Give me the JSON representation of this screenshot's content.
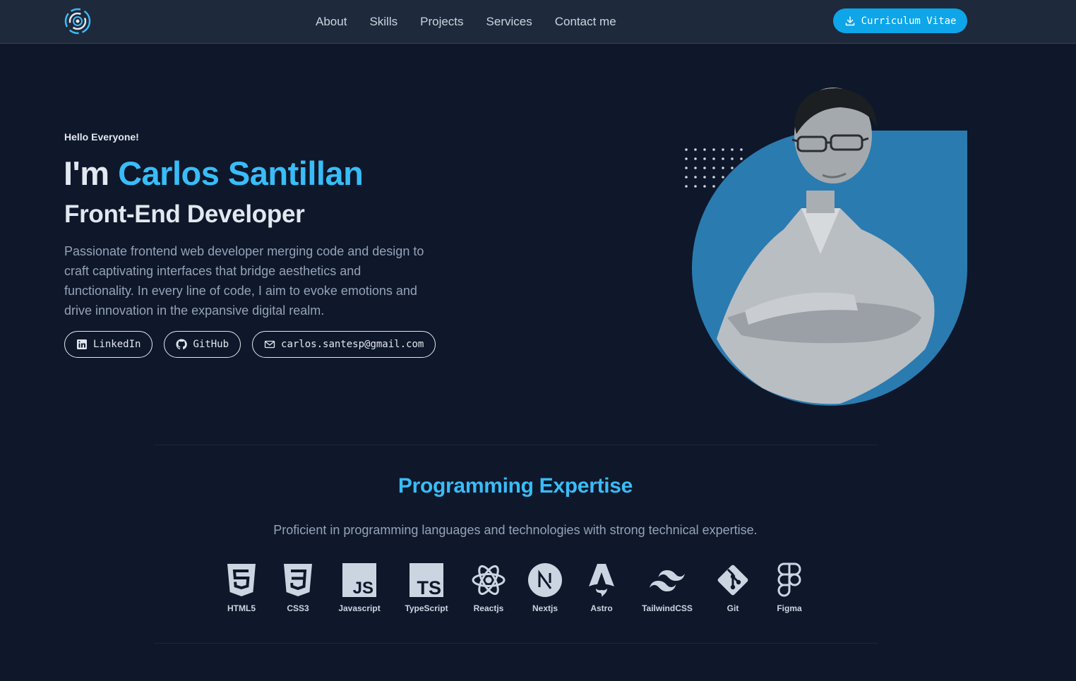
{
  "nav": {
    "items": [
      {
        "label": "About"
      },
      {
        "label": "Skills"
      },
      {
        "label": "Projects"
      },
      {
        "label": "Services"
      },
      {
        "label": "Contact me"
      }
    ],
    "cv_label": "Curriculum Vitae"
  },
  "hero": {
    "greeting": "Hello Everyone!",
    "name_prefix": "I'm ",
    "name": "Carlos Santillan",
    "role": "Front-End Developer",
    "description": "Passionate frontend web developer merging code and design to craft captivating interfaces that bridge aesthetics and functionality. In every line of code, I aim to evoke emotions and drive innovation in the expansive digital realm.",
    "links": {
      "linkedin": "LinkedIn",
      "github": "GitHub",
      "email": "carlos.santesp@gmail.com"
    }
  },
  "skills": {
    "title": "Programming Expertise",
    "subtitle": "Proficient in programming languages and technologies with strong technical expertise.",
    "items": [
      {
        "label": "HTML5",
        "icon": "html5-icon"
      },
      {
        "label": "CSS3",
        "icon": "css3-icon"
      },
      {
        "label": "Javascript",
        "icon": "javascript-icon"
      },
      {
        "label": "TypeScript",
        "icon": "typescript-icon"
      },
      {
        "label": "Reactjs",
        "icon": "react-icon"
      },
      {
        "label": "Nextjs",
        "icon": "nextjs-icon"
      },
      {
        "label": "Astro",
        "icon": "astro-icon"
      },
      {
        "label": "TailwindCSS",
        "icon": "tailwind-icon"
      },
      {
        "label": "Git",
        "icon": "git-icon"
      },
      {
        "label": "Figma",
        "icon": "figma-icon"
      }
    ]
  },
  "colors": {
    "background": "#0f172a",
    "header": "#1e293b",
    "accent": "#38bdf8",
    "button": "#0ea5e9",
    "photo_bg": "#2a7bb0"
  }
}
